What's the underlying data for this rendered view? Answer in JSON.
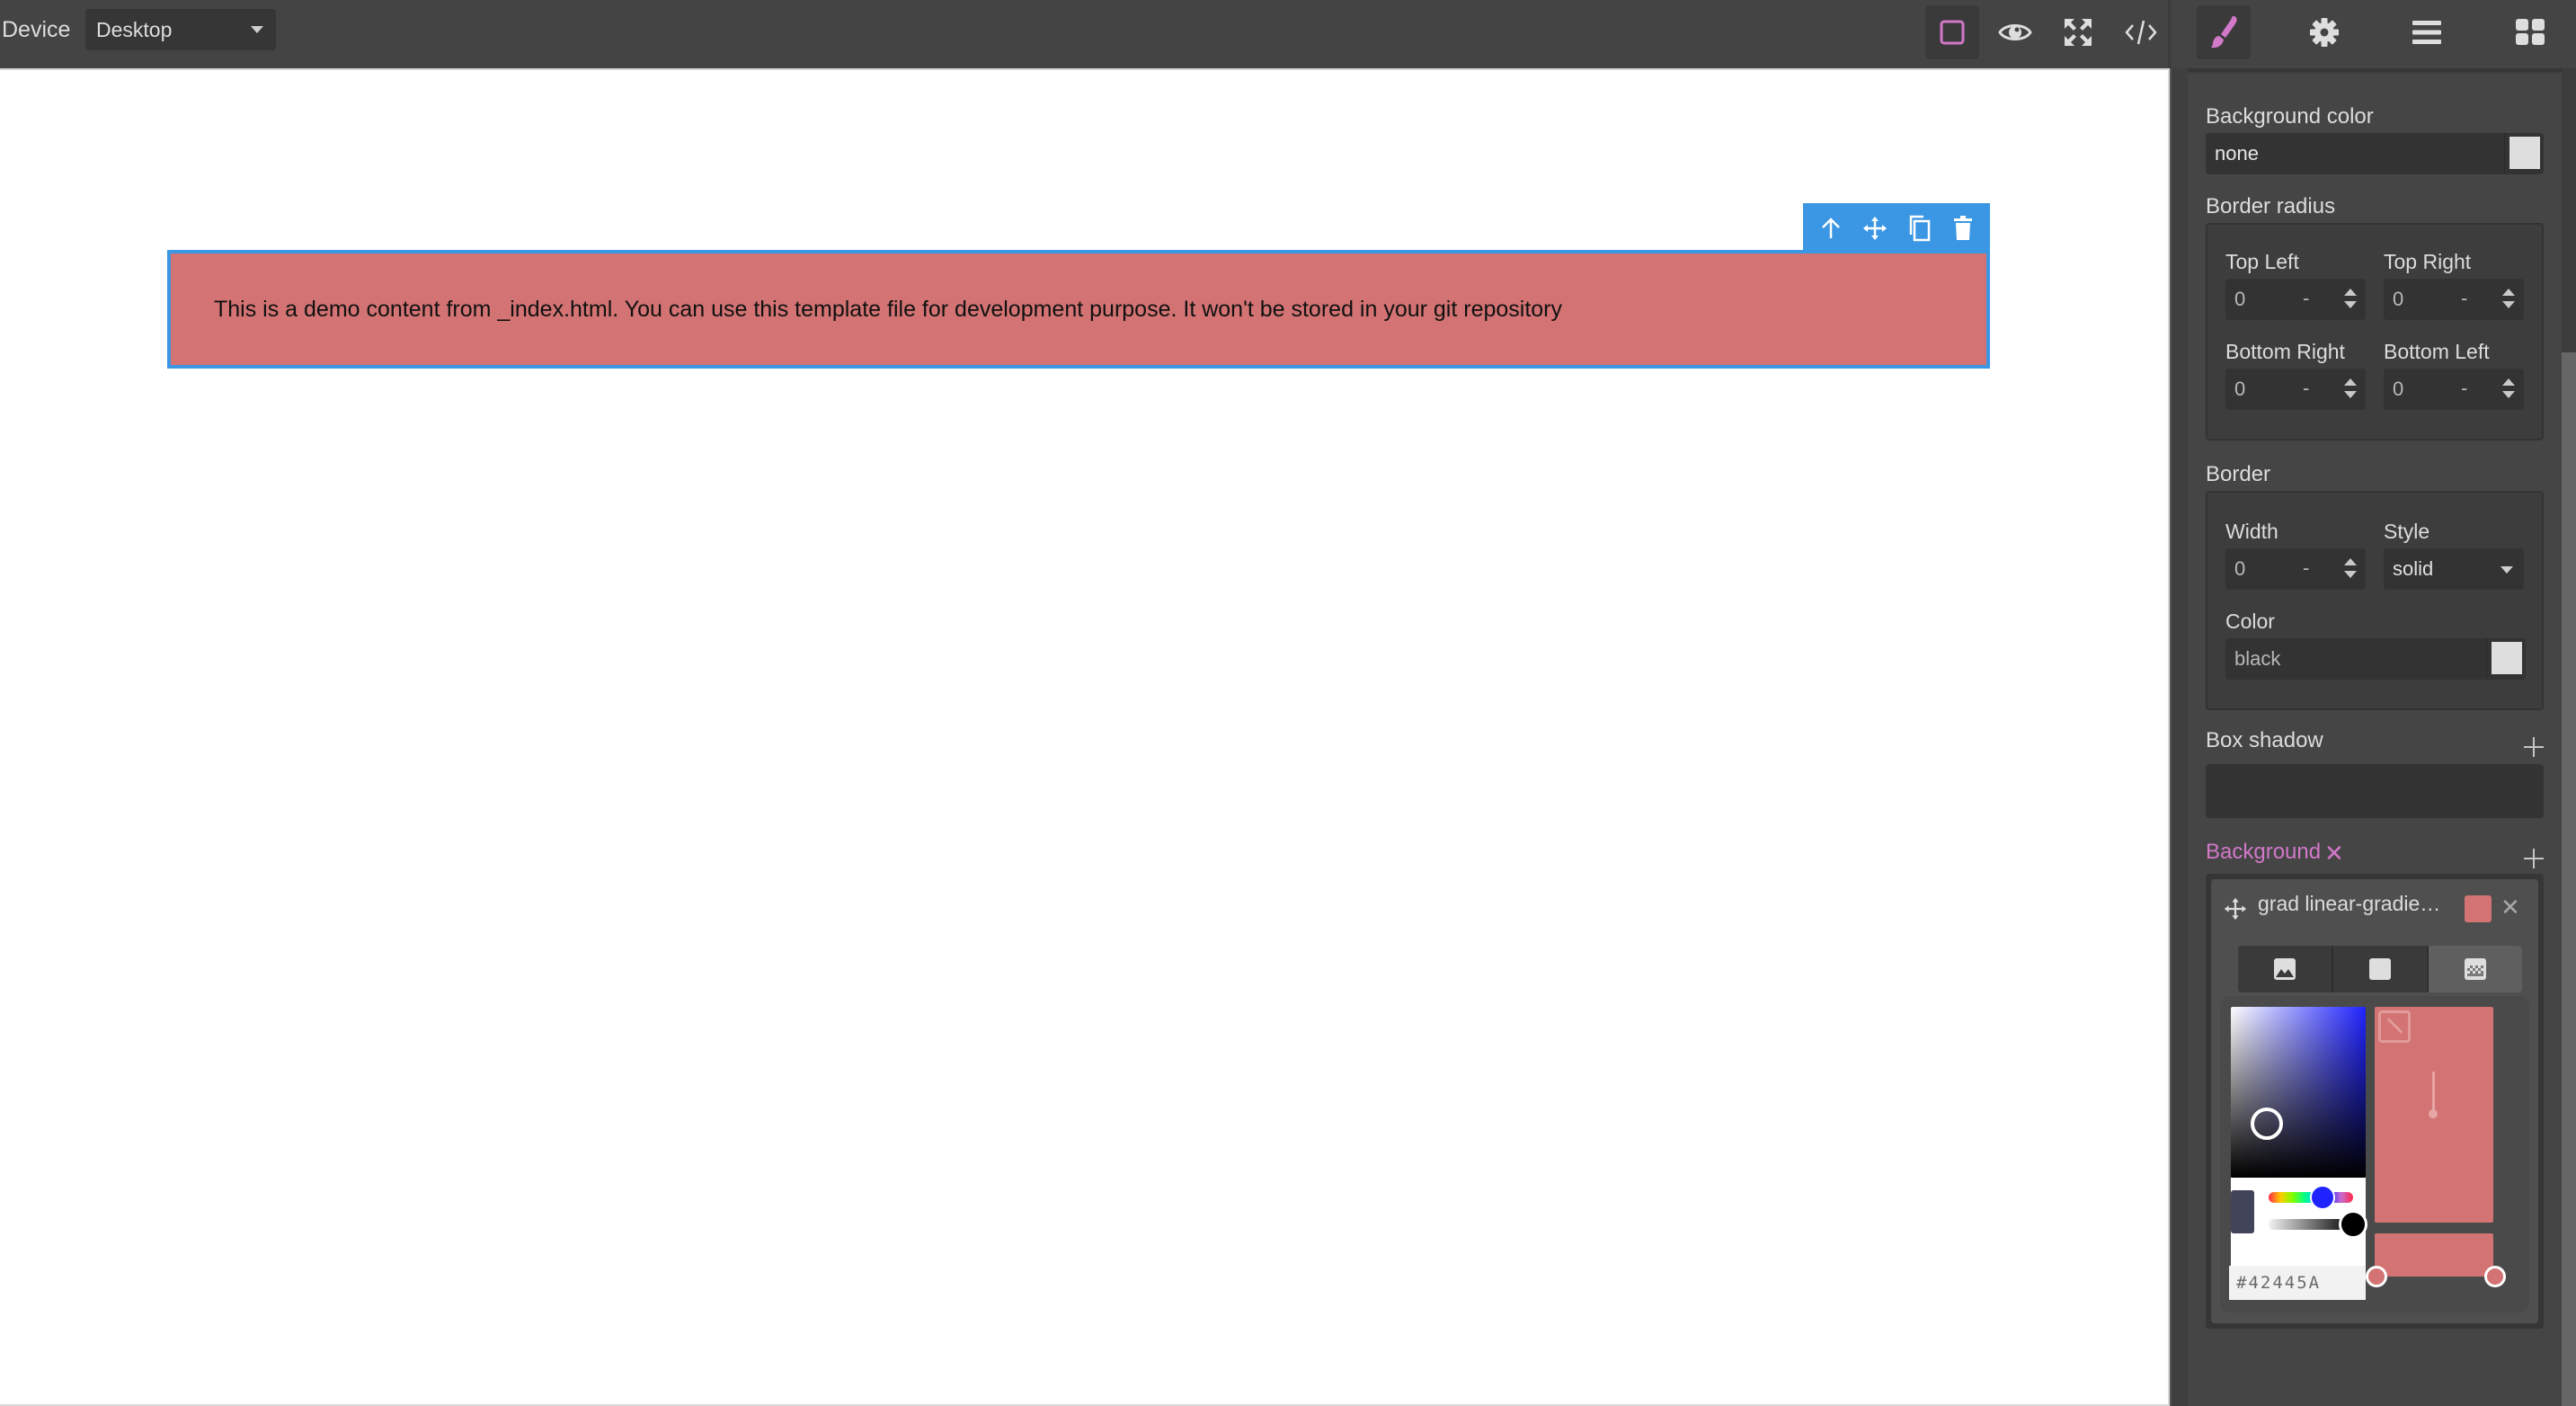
{
  "topbar": {
    "device_label": "Device",
    "device_value": "Desktop",
    "view_buttons": [
      {
        "name": "sw-visibility",
        "icon": "square-outline-icon",
        "active": true
      },
      {
        "name": "preview",
        "icon": "eye-icon",
        "active": false
      },
      {
        "name": "fullscreen",
        "icon": "expand-arrows-icon",
        "active": false
      },
      {
        "name": "export-code",
        "icon": "code-icon",
        "active": false
      }
    ],
    "panel_buttons": [
      {
        "name": "style-manager",
        "icon": "paint-brush-icon",
        "active": true
      },
      {
        "name": "settings",
        "icon": "gear-icon",
        "active": false
      },
      {
        "name": "layer-manager",
        "icon": "bars-icon",
        "active": false
      },
      {
        "name": "blocks",
        "icon": "grid-icon",
        "active": false
      }
    ],
    "accent_color": "#d278c9"
  },
  "canvas": {
    "selected_block": {
      "text": "This is a demo content from _index.html. You can use this template file for development purpose. It won't be stored in your git repository",
      "background_color": "#d37373",
      "selection_color": "#3b97e3"
    },
    "block_toolbar": [
      "arrow-up-icon",
      "move-icon",
      "copy-icon",
      "trash-icon"
    ]
  },
  "style_panel": {
    "background_color": {
      "label": "Background color",
      "value": "none"
    },
    "border_radius": {
      "label": "Border radius",
      "fields": [
        {
          "label": "Top Left",
          "value": "0",
          "unit": "-"
        },
        {
          "label": "Top Right",
          "value": "0",
          "unit": "-"
        },
        {
          "label": "Bottom Right",
          "value": "0",
          "unit": "-"
        },
        {
          "label": "Bottom Left",
          "value": "0",
          "unit": "-"
        }
      ]
    },
    "border": {
      "label": "Border",
      "width": {
        "label": "Width",
        "value": "0",
        "unit": "-"
      },
      "style": {
        "label": "Style",
        "value": "solid"
      },
      "color": {
        "label": "Color",
        "value": "black"
      }
    },
    "box_shadow": {
      "label": "Box shadow"
    },
    "background": {
      "label": "Background",
      "layer": {
        "name": "grad linear-gradie…",
        "swatch_color": "#d37373",
        "type_tabs": [
          "image-icon",
          "solid-color-icon",
          "gradient-icon"
        ],
        "active_type": "gradient"
      },
      "picker": {
        "hex_value": "#42445A",
        "hue_color": "#1f23ff"
      },
      "gradient_stops": 2
    }
  }
}
